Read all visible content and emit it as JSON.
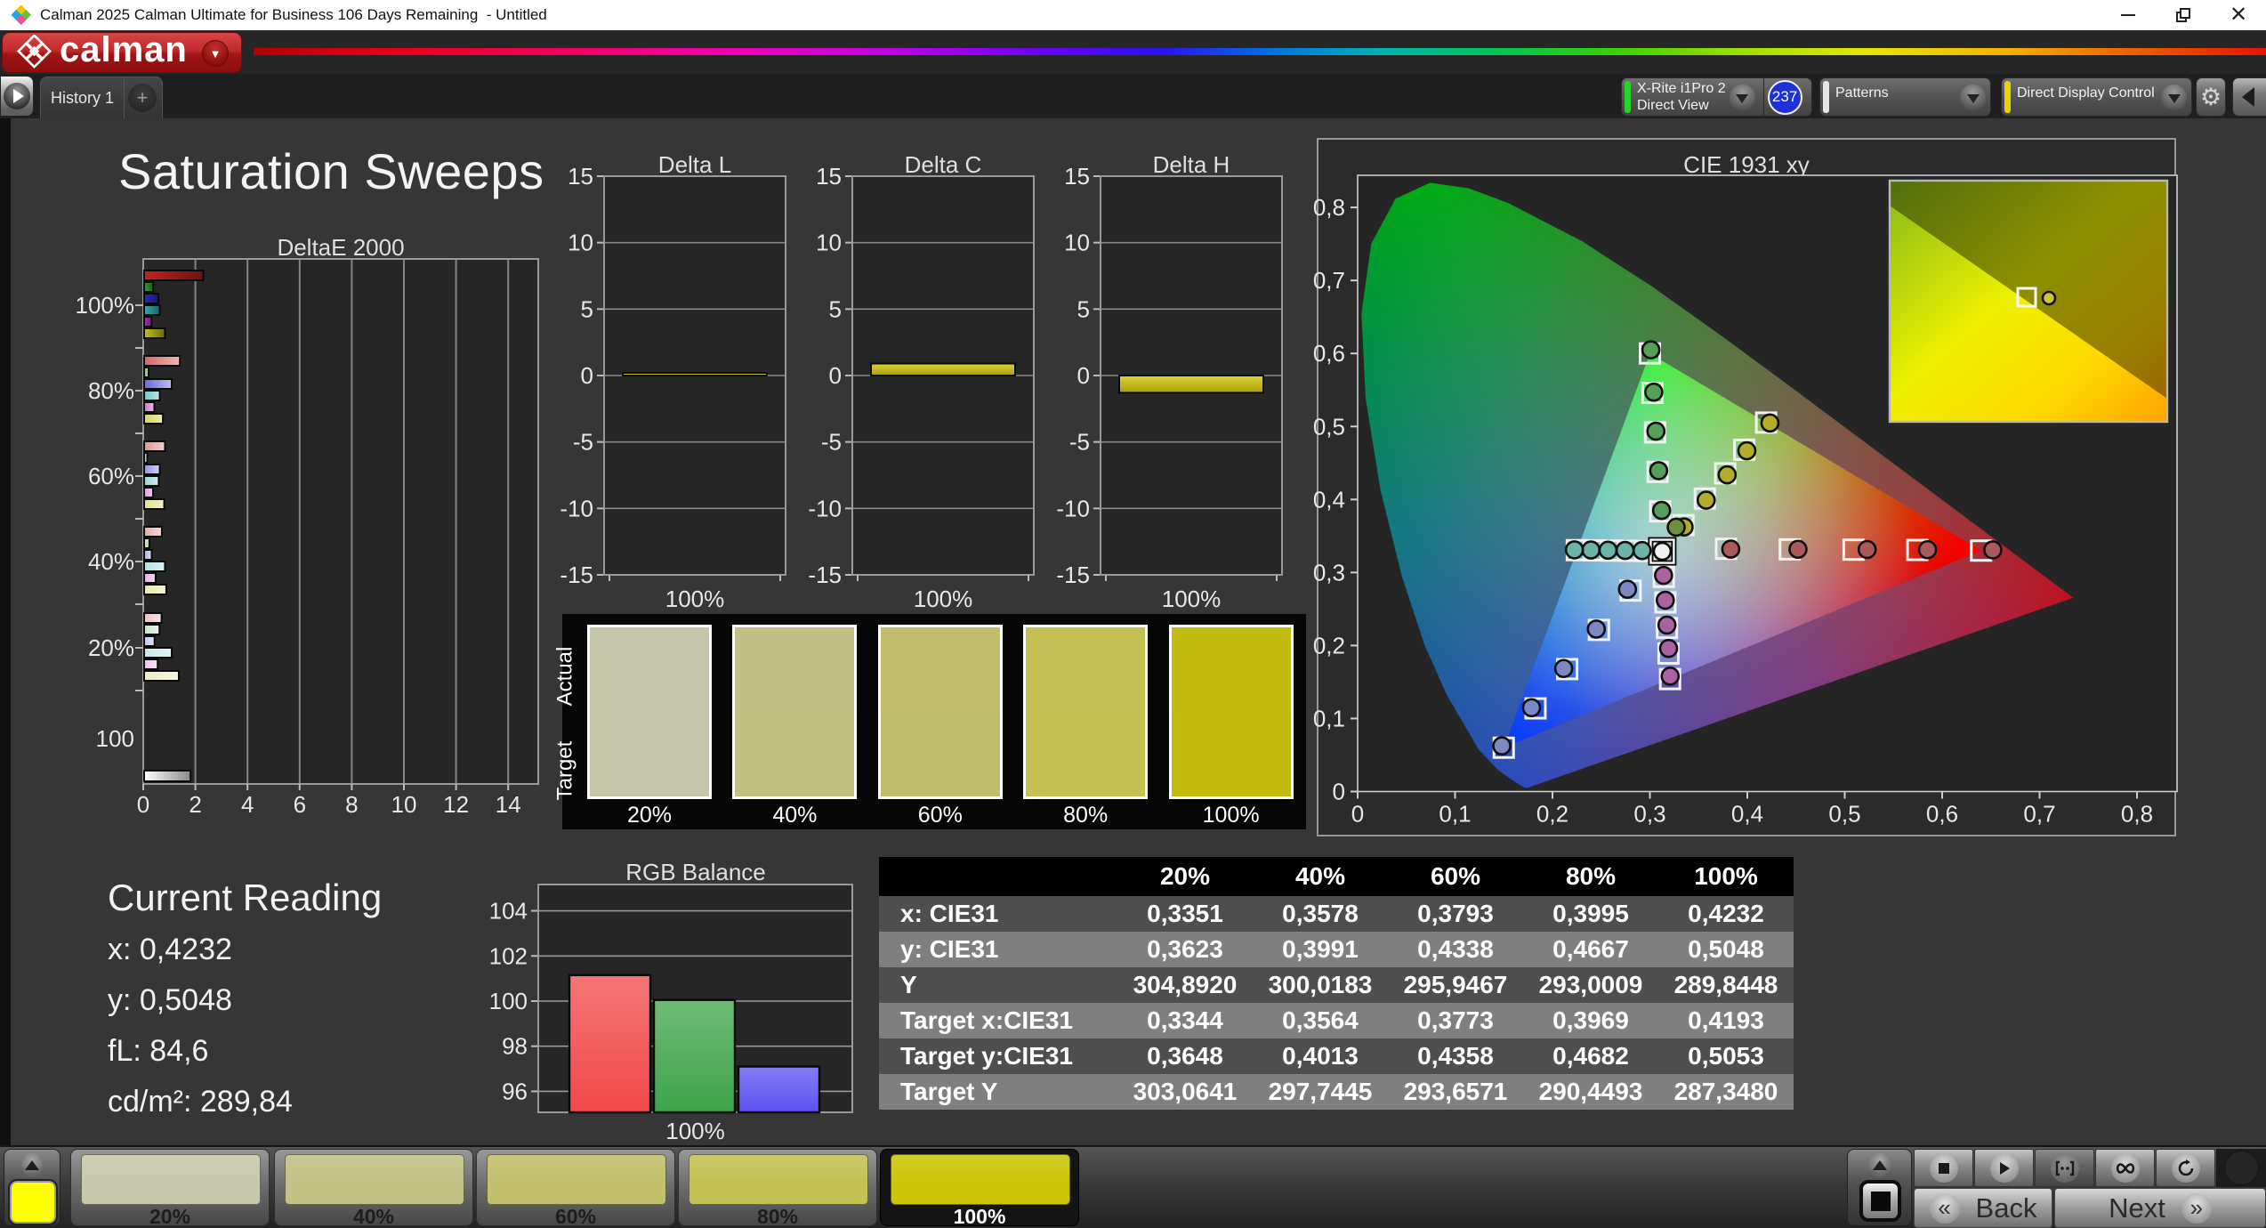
{
  "window": {
    "title": "Calman 2025 Calman Ultimate for Business 106 Days Remaining  - Untitled",
    "controls": {
      "minimize": "minimize",
      "restore": "restore",
      "close": "close"
    }
  },
  "brand": {
    "logo_text": "calman"
  },
  "tabs": {
    "history": "History 1",
    "add": "+"
  },
  "toolbar": {
    "meter": {
      "line1": "X-Rite i1Pro 2",
      "line2": "Direct View",
      "stripe_color": "#27d427",
      "badge": "237",
      "badge_color": "#1e31d8"
    },
    "patterns": {
      "label": "Patterns",
      "stripe_color": "#e6e6e6"
    },
    "display_control": {
      "label": "Direct Display Control",
      "stripe_color": "#e8d400"
    }
  },
  "page": {
    "title": "Saturation Sweeps"
  },
  "current_reading": {
    "title": "Current Reading",
    "lines": [
      "x: 0,4232",
      "y: 0,5048",
      "fL: 84,6",
      "cd/m²: 289,84"
    ]
  },
  "table": {
    "columns": [
      "",
      "20%",
      "40%",
      "60%",
      "80%",
      "100%"
    ],
    "rows": [
      {
        "label": "x: CIE31",
        "values": [
          "0,3351",
          "0,3578",
          "0,3793",
          "0,3995",
          "0,4232"
        ]
      },
      {
        "label": "y: CIE31",
        "values": [
          "0,3623",
          "0,3991",
          "0,4338",
          "0,4667",
          "0,5048"
        ]
      },
      {
        "label": "Y",
        "values": [
          "304,8920",
          "300,0183",
          "295,9467",
          "293,0009",
          "289,8448"
        ]
      },
      {
        "label": "Target x:CIE31",
        "values": [
          "0,3344",
          "0,3564",
          "0,3773",
          "0,3969",
          "0,4193"
        ]
      },
      {
        "label": "Target y:CIE31",
        "values": [
          "0,3648",
          "0,4013",
          "0,4358",
          "0,4682",
          "0,5053"
        ]
      },
      {
        "label": "Target Y",
        "values": [
          "303,0641",
          "297,7445",
          "293,6571",
          "290,4493",
          "287,3480"
        ]
      }
    ]
  },
  "swatch_strip": {
    "row_labels": [
      "Actual",
      "Target"
    ],
    "labels": [
      "20%",
      "40%",
      "60%",
      "80%",
      "100%"
    ],
    "actual_colors": [
      "#c5c6a9",
      "#c1bf85",
      "#c1bd6b",
      "#c4bf55",
      "#c2bc10"
    ],
    "target_colors": [
      "#c4c5a8",
      "#c1c083",
      "#c0bd6a",
      "#c4c053",
      "#c1bb0d"
    ]
  },
  "pattern_bar": {
    "labels": [
      "20%",
      "40%",
      "60%",
      "80%",
      "100%"
    ],
    "colors": [
      "#c8c9ac",
      "#c3c184",
      "#c3bf6b",
      "#c5c054",
      "#cbc50a"
    ],
    "selected": 4,
    "picker_color": "#ffff00"
  },
  "nav": {
    "back": "Back",
    "next": "Next"
  },
  "chart_data": [
    {
      "id": "delta_e_2000",
      "type": "bar",
      "title": "DeltaE 2000",
      "orientation": "horizontal",
      "categories": [
        "100%",
        "80%",
        "60%",
        "40%",
        "20%"
      ],
      "series": [
        {
          "name": "red",
          "color": "#c42222",
          "values": [
            2.27,
            1.37,
            0.8,
            0.68,
            0.67
          ]
        },
        {
          "name": "green",
          "color": "#2fa42f",
          "values": [
            0.35,
            0.17,
            0.12,
            0.2,
            0.59
          ]
        },
        {
          "name": "blue",
          "color": "#2a2ac8",
          "values": [
            0.55,
            1.06,
            0.6,
            0.29,
            0.4
          ]
        },
        {
          "name": "cyan",
          "color": "#2fb0b0",
          "values": [
            0.6,
            0.6,
            0.56,
            0.8,
            1.06
          ]
        },
        {
          "name": "magenta",
          "color": "#c428c4",
          "values": [
            0.29,
            0.39,
            0.34,
            0.44,
            0.52
          ]
        },
        {
          "name": "yellow",
          "color": "#c2c21e",
          "values": [
            0.8,
            0.72,
            0.77,
            0.85,
            1.33
          ]
        }
      ],
      "white_row": {
        "label": "100",
        "value": 1.78,
        "color": "#ffffff"
      },
      "xlim": [
        0,
        15.2
      ],
      "x_ticks": [
        0,
        2,
        4,
        6,
        8,
        10,
        12,
        14
      ]
    },
    {
      "id": "delta_l",
      "type": "bar",
      "title": "Delta L",
      "categories": [
        "100%"
      ],
      "values": [
        0.2
      ],
      "ylim": [
        -15,
        15
      ],
      "y_ticks": [
        15,
        10,
        5,
        0,
        -5,
        -10,
        -15
      ],
      "bar_color": "#c8c020"
    },
    {
      "id": "delta_c",
      "type": "bar",
      "title": "Delta C",
      "categories": [
        "100%"
      ],
      "values": [
        0.9
      ],
      "ylim": [
        -15,
        15
      ],
      "y_ticks": [
        15,
        10,
        5,
        0,
        -5,
        -10,
        -15
      ],
      "bar_color": "#c8c020"
    },
    {
      "id": "delta_h",
      "type": "bar",
      "title": "Delta H",
      "categories": [
        "100%"
      ],
      "values": [
        -1.3
      ],
      "ylim": [
        -15,
        15
      ],
      "y_ticks": [
        15,
        10,
        5,
        0,
        -5,
        -10,
        -15
      ],
      "bar_color": "#c8c020"
    },
    {
      "id": "rgb_balance",
      "type": "bar",
      "title": "RGB Balance",
      "categories": [
        "R",
        "G",
        "B"
      ],
      "values": [
        101.15,
        100.05,
        97.1
      ],
      "colors": [
        "#f24848",
        "#3da44a",
        "#5b52f0"
      ],
      "ylim": [
        95.2,
        105.1
      ],
      "y_ticks": [
        104,
        102,
        100,
        98,
        96
      ],
      "xlabel": "100%"
    },
    {
      "id": "cie_1931",
      "type": "scatter",
      "title": "CIE 1931 xy",
      "xlim": [
        0,
        0.84
      ],
      "ylim": [
        0,
        0.844
      ],
      "x_ticks": [
        "0",
        "0,1",
        "0,2",
        "0,3",
        "0,4",
        "0,5",
        "0,6",
        "0,7",
        "0,8"
      ],
      "y_ticks": [
        "0",
        "0,1",
        "0,2",
        "0,3",
        "0,4",
        "0,5",
        "0,6",
        "0,7",
        "0,8"
      ],
      "gamut_triangle": {
        "red": [
          0.64,
          0.33
        ],
        "green": [
          0.3,
          0.6
        ],
        "blue": [
          0.15,
          0.06
        ]
      },
      "white_point": [
        0.3127,
        0.329
      ],
      "locus": [
        [
          0.1741,
          0.005
        ],
        [
          0.1714,
          0.0051
        ],
        [
          0.1689,
          0.0069
        ],
        [
          0.1644,
          0.0109
        ],
        [
          0.1566,
          0.0177
        ],
        [
          0.144,
          0.0297
        ],
        [
          0.1241,
          0.0578
        ],
        [
          0.0913,
          0.1327
        ],
        [
          0.0687,
          0.2007
        ],
        [
          0.0454,
          0.295
        ],
        [
          0.0235,
          0.4127
        ],
        [
          0.0082,
          0.5384
        ],
        [
          0.0039,
          0.6548
        ],
        [
          0.0139,
          0.7502
        ],
        [
          0.0389,
          0.812
        ],
        [
          0.0743,
          0.8338
        ],
        [
          0.1142,
          0.8262
        ],
        [
          0.1547,
          0.8059
        ],
        [
          0.2296,
          0.7543
        ],
        [
          0.3016,
          0.6923
        ],
        [
          0.3731,
          0.6245
        ],
        [
          0.4441,
          0.5547
        ],
        [
          0.5125,
          0.4866
        ],
        [
          0.5752,
          0.4242
        ],
        [
          0.627,
          0.3725
        ],
        [
          0.6658,
          0.334
        ],
        [
          0.6915,
          0.3083
        ],
        [
          0.7079,
          0.292
        ],
        [
          0.719,
          0.2809
        ],
        [
          0.7347,
          0.2653
        ]
      ],
      "sweeps": [
        {
          "name": "yellow",
          "dot_color": "#b6ac2c",
          "targets": [
            [
              0.3344,
              0.3648
            ],
            [
              0.3564,
              0.4013
            ],
            [
              0.3773,
              0.4358
            ],
            [
              0.3969,
              0.4682
            ],
            [
              0.4193,
              0.5053
            ]
          ],
          "measured": [
            [
              0.3351,
              0.3623
            ],
            [
              0.3578,
              0.3991
            ],
            [
              0.3793,
              0.4338
            ],
            [
              0.3995,
              0.4667
            ],
            [
              0.4232,
              0.5048
            ]
          ]
        },
        {
          "name": "red",
          "dot_color": "#aa5a5a",
          "targets": [
            [
              0.3781,
              0.3325
            ],
            [
              0.4436,
              0.3317
            ],
            [
              0.509,
              0.3313
            ],
            [
              0.5745,
              0.3309
            ],
            [
              0.64,
              0.33
            ]
          ],
          "measured": [
            [
              0.383,
              0.332
            ],
            [
              0.452,
              0.3318
            ],
            [
              0.523,
              0.3315
            ],
            [
              0.585,
              0.3312
            ],
            [
              0.652,
              0.331
            ]
          ]
        },
        {
          "name": "green",
          "dot_color": "#55a058",
          "targets": [
            [
              0.3106,
              0.3837
            ],
            [
              0.3079,
              0.4378
            ],
            [
              0.3053,
              0.4919
            ],
            [
              0.3026,
              0.546
            ],
            [
              0.3,
              0.6
            ]
          ],
          "measured": [
            [
              0.312,
              0.385
            ],
            [
              0.309,
              0.4395
            ],
            [
              0.3062,
              0.4935
            ],
            [
              0.304,
              0.547
            ],
            [
              0.301,
              0.605
            ]
          ]
        },
        {
          "name": "blue",
          "dot_color": "#7d88c4",
          "targets": [
            [
              0.2802,
              0.2752
            ],
            [
              0.2477,
              0.2214
            ],
            [
              0.2151,
              0.1677
            ],
            [
              0.1826,
              0.1139
            ],
            [
              0.15,
              0.06
            ]
          ],
          "measured": [
            [
              0.277,
              0.277
            ],
            [
              0.245,
              0.2225
            ],
            [
              0.2115,
              0.1685
            ],
            [
              0.1785,
              0.1148
            ],
            [
              0.148,
              0.0625
            ]
          ]
        },
        {
          "name": "cyan",
          "dot_color": "#6cb4aa",
          "targets": [
            [
              0.2952,
              0.3294
            ],
            [
              0.2776,
              0.3297
            ],
            [
              0.2601,
              0.33
            ],
            [
              0.2425,
              0.3303
            ],
            [
              0.225,
              0.3306
            ]
          ],
          "measured": [
            [
              0.292,
              0.33
            ],
            [
              0.2745,
              0.3302
            ],
            [
              0.257,
              0.3305
            ],
            [
              0.2395,
              0.3308
            ],
            [
              0.2225,
              0.331
            ]
          ]
        },
        {
          "name": "magenta",
          "dot_color": "#aa62a2",
          "targets": [
            [
              0.3143,
              0.294
            ],
            [
              0.3159,
              0.259
            ],
            [
              0.3175,
              0.224
            ],
            [
              0.3191,
              0.189
            ],
            [
              0.3207,
              0.154
            ]
          ],
          "measured": [
            [
              0.314,
              0.296
            ],
            [
              0.3158,
              0.262
            ],
            [
              0.3175,
              0.228
            ],
            [
              0.3192,
              0.196
            ],
            [
              0.3208,
              0.158
            ]
          ]
        }
      ],
      "extra_points": [
        {
          "xy": [
            0.327,
            0.362
          ],
          "color": "#6f8f3f"
        }
      ],
      "inset": {
        "target": [
          0.4193,
          0.5053
        ],
        "measured": [
          0.4232,
          0.5048
        ]
      }
    }
  ]
}
